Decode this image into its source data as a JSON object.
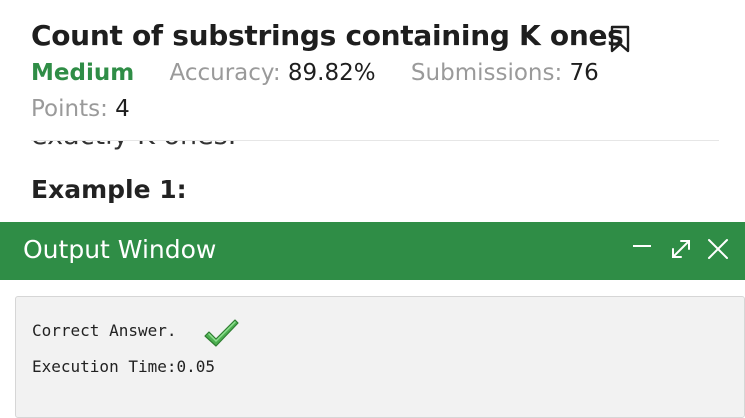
{
  "problem": {
    "title": "Count of substrings containing K ones",
    "difficulty": "Medium",
    "accuracy_label": "Accuracy:",
    "accuracy_value": "89.82%",
    "submissions_label": "Submissions:",
    "submissions_value": "76",
    "points_label": "Points:",
    "points_value": "4"
  },
  "body": {
    "partial_text": "exactly K ones.",
    "example_heading": "Example 1:"
  },
  "output_window": {
    "title": "Output Window",
    "result_text": "Correct Answer.",
    "execution_text": "Execution Time:0.05"
  },
  "colors": {
    "brand_green": "#2f8d46",
    "check_green": "#4caf50"
  },
  "icons": {
    "bookmark": "bookmark-icon",
    "minimize": "minimize-icon",
    "maximize": "expand-icon",
    "close": "close-icon",
    "check": "checkmark-icon"
  }
}
